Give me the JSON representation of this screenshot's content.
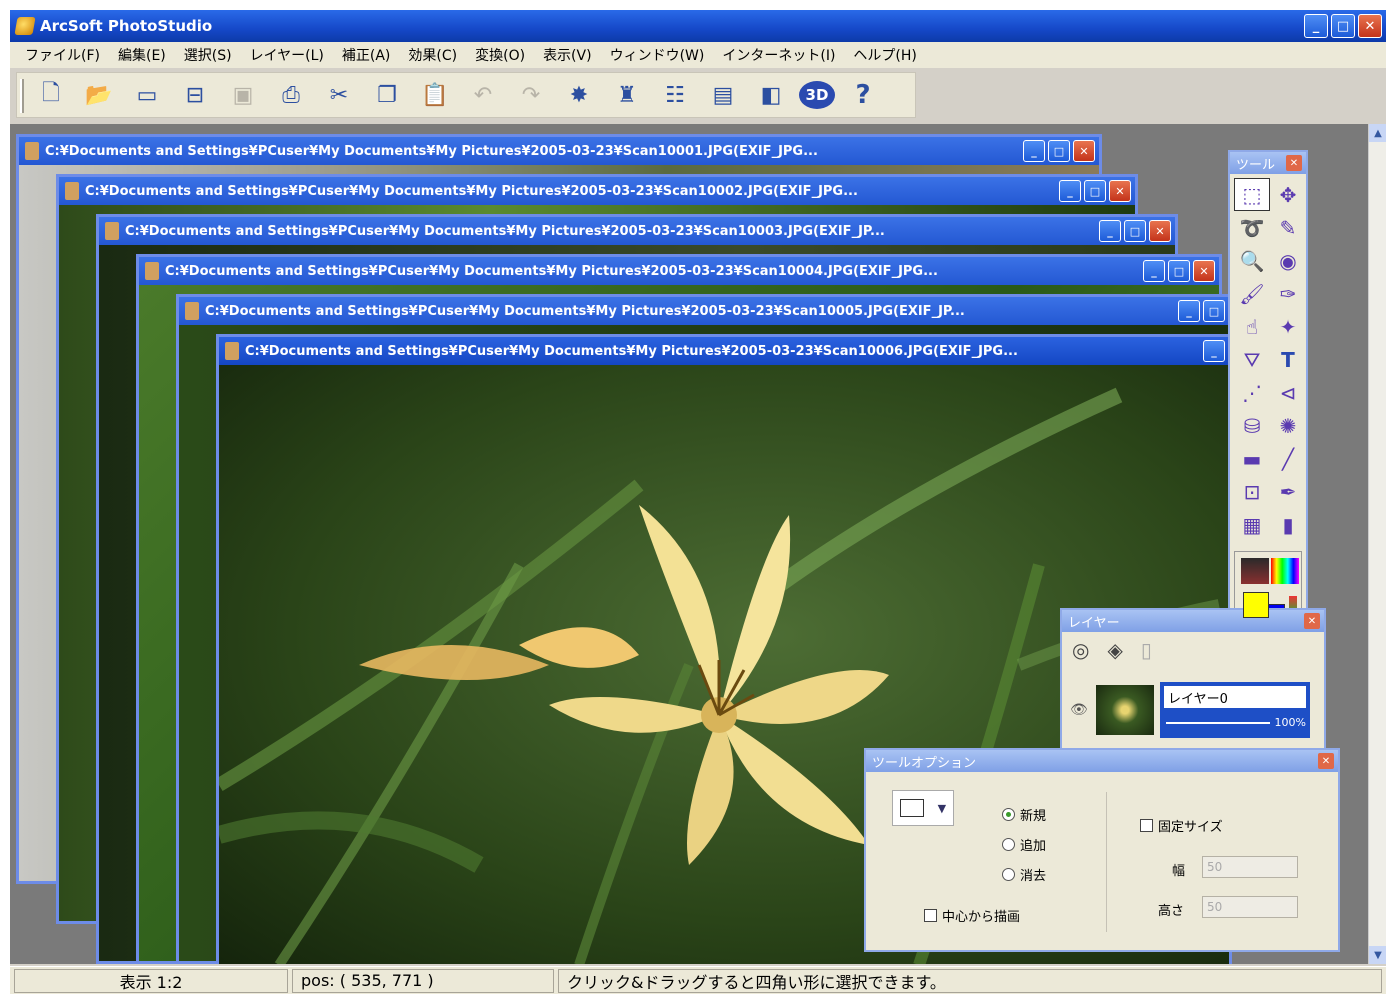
{
  "app": {
    "title": "ArcSoft PhotoStudio"
  },
  "menu": [
    "ファイル(F)",
    "編集(E)",
    "選択(S)",
    "レイヤー(L)",
    "補正(A)",
    "効果(C)",
    "変換(O)",
    "表示(V)",
    "ウィンドウ(W)",
    "インターネット(I)",
    "ヘルプ(H)"
  ],
  "toolbar": [
    {
      "name": "new-icon",
      "glyph": "🗋",
      "disabled": false
    },
    {
      "name": "open-icon",
      "glyph": "📂",
      "disabled": false
    },
    {
      "name": "acquire-icon",
      "glyph": "▭",
      "disabled": false
    },
    {
      "name": "scanner-icon",
      "glyph": "⊟",
      "disabled": false
    },
    {
      "name": "save-icon",
      "glyph": "▣",
      "disabled": true
    },
    {
      "name": "print-icon",
      "glyph": "⎙",
      "disabled": false
    },
    {
      "name": "cut-icon",
      "glyph": "✂",
      "disabled": false
    },
    {
      "name": "copy-icon",
      "glyph": "❐",
      "disabled": false
    },
    {
      "name": "paste-icon",
      "glyph": "📋",
      "disabled": true
    },
    {
      "name": "undo-icon",
      "glyph": "↶",
      "disabled": true
    },
    {
      "name": "redo-icon",
      "glyph": "↷",
      "disabled": true
    },
    {
      "name": "magic-icon",
      "glyph": "✸",
      "disabled": false
    },
    {
      "name": "fix-icon",
      "glyph": "♜",
      "disabled": false
    },
    {
      "name": "adjust-icon",
      "glyph": "☷",
      "disabled": false
    },
    {
      "name": "album-icon",
      "glyph": "▤",
      "disabled": false
    },
    {
      "name": "disc-icon",
      "glyph": "◧",
      "disabled": false
    },
    {
      "name": "3d-icon",
      "glyph": "3D",
      "disabled": false
    },
    {
      "name": "help-icon",
      "glyph": "?",
      "disabled": false
    }
  ],
  "documents": [
    {
      "title": "C:¥Documents and Settings¥PCuser¥My Documents¥My Pictures¥2005-03-23¥Scan10001.JPG(EXIF_JPG..."
    },
    {
      "title": "C:¥Documents and Settings¥PCuser¥My Documents¥My Pictures¥2005-03-23¥Scan10002.JPG(EXIF_JPG..."
    },
    {
      "title": "C:¥Documents and Settings¥PCuser¥My Documents¥My Pictures¥2005-03-23¥Scan10003.JPG(EXIF_JP..."
    },
    {
      "title": "C:¥Documents and Settings¥PCuser¥My Documents¥My Pictures¥2005-03-23¥Scan10004.JPG(EXIF_JPG..."
    },
    {
      "title": "C:¥Documents and Settings¥PCuser¥My Documents¥My Pictures¥2005-03-23¥Scan10005.JPG(EXIF_JP..."
    },
    {
      "title": "C:¥Documents and Settings¥PCuser¥My Documents¥My Pictures¥2005-03-23¥Scan10006.JPG(EXIF_JPG..."
    }
  ],
  "tools_panel": {
    "title": "ツール"
  },
  "layers_panel": {
    "title": "レイヤー",
    "layer_name": "レイヤー0",
    "opacity": "100%"
  },
  "tool_options": {
    "title": "ツールオプション",
    "radios": [
      {
        "label": "新規",
        "checked": true
      },
      {
        "label": "追加",
        "checked": false
      },
      {
        "label": "消去",
        "checked": false
      }
    ],
    "center_draw": "中心から描画",
    "fixed_size": "固定サイズ",
    "width_label": "幅",
    "width_value": "50",
    "height_label": "高さ",
    "height_value": "50"
  },
  "status": {
    "zoom": "表示 1:2",
    "pos": "pos: ( 535, 771 )",
    "hint": "クリック&ドラッグすると四角い形に選択できます。"
  }
}
